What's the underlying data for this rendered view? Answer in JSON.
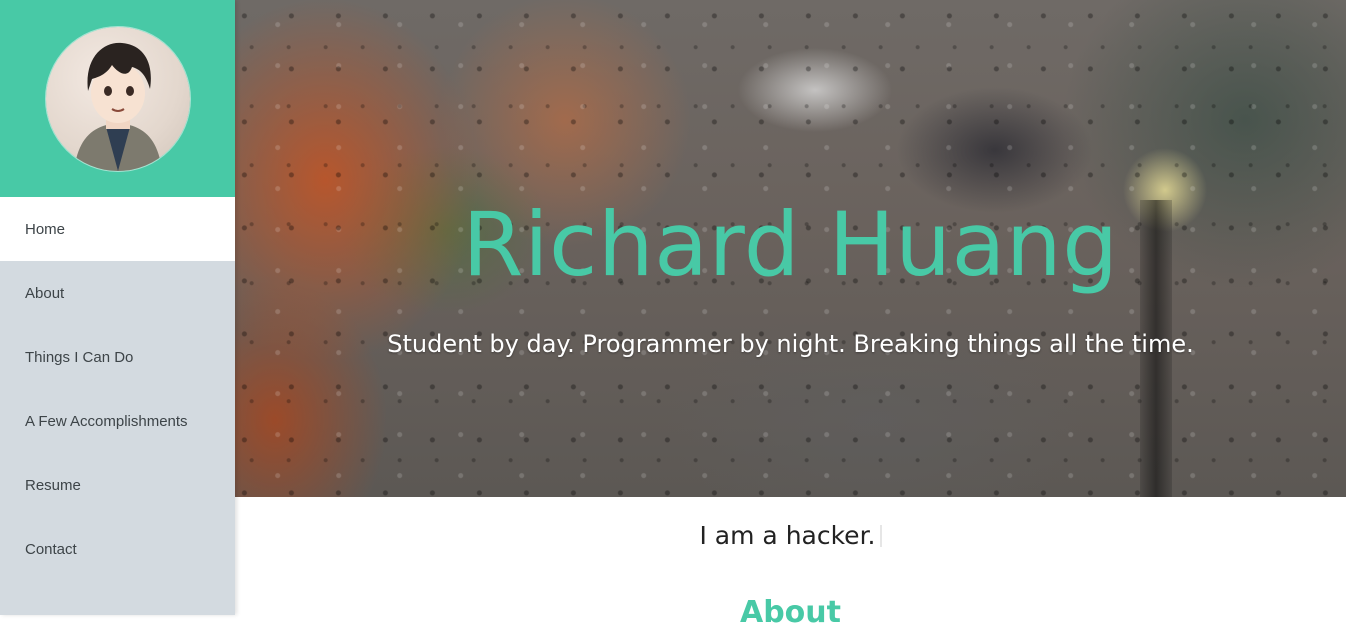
{
  "brand": {
    "accent": "#48c9a6",
    "sidebar_bg": "#d3dae0"
  },
  "sidebar": {
    "avatar": {
      "icon": "avatar-illustration"
    },
    "items": [
      {
        "label": "Home",
        "active": true
      },
      {
        "label": "About",
        "active": false
      },
      {
        "label": "Things I Can Do",
        "active": false
      },
      {
        "label": "A Few Accomplishments",
        "active": false
      },
      {
        "label": "Resume",
        "active": false
      },
      {
        "label": "Contact",
        "active": false
      }
    ]
  },
  "hero": {
    "name": "Richard Huang",
    "tagline": "Student by day. Programmer by night. Breaking things all the time."
  },
  "main": {
    "typed_text": "I am a hacker.",
    "section_heading": "About"
  }
}
